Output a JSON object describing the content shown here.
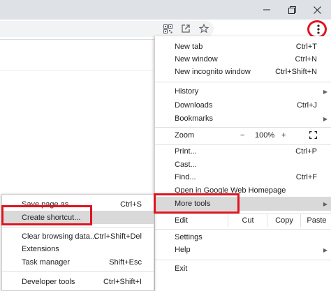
{
  "window": {
    "minimize_icon": "minimize-icon",
    "maximize_icon": "restore-icon",
    "close_icon": "close-icon"
  },
  "toolbar": {
    "icons": [
      "qr-code-icon",
      "open-in-new-icon",
      "star-icon",
      "more-vert-icon"
    ]
  },
  "menu": {
    "new_tab": {
      "label": "New tab",
      "shortcut": "Ctrl+T"
    },
    "new_window": {
      "label": "New window",
      "shortcut": "Ctrl+N"
    },
    "new_incognito": {
      "label": "New incognito window",
      "shortcut": "Ctrl+Shift+N"
    },
    "history": {
      "label": "History"
    },
    "downloads": {
      "label": "Downloads",
      "shortcut": "Ctrl+J"
    },
    "bookmarks": {
      "label": "Bookmarks"
    },
    "zoom": {
      "label": "Zoom",
      "minus": "−",
      "value": "100%",
      "plus": "+"
    },
    "print": {
      "label": "Print...",
      "shortcut": "Ctrl+P"
    },
    "cast": {
      "label": "Cast..."
    },
    "find": {
      "label": "Find...",
      "shortcut": "Ctrl+F"
    },
    "open_in": {
      "label": "Open in Google Web Homepage"
    },
    "more_tools": {
      "label": "More tools"
    },
    "edit": {
      "label": "Edit",
      "cut": "Cut",
      "copy": "Copy",
      "paste": "Paste"
    },
    "settings": {
      "label": "Settings"
    },
    "help": {
      "label": "Help"
    },
    "exit": {
      "label": "Exit"
    }
  },
  "submenu": {
    "save_page": {
      "label": "Save page as...",
      "shortcut": "Ctrl+S"
    },
    "create_shortcut": {
      "label": "Create shortcut..."
    },
    "clear_browsing": {
      "label": "Clear browsing data...",
      "shortcut": "Ctrl+Shift+Del"
    },
    "extensions": {
      "label": "Extensions"
    },
    "task_manager": {
      "label": "Task manager",
      "shortcut": "Shift+Esc"
    },
    "developer_tools": {
      "label": "Developer tools",
      "shortcut": "Ctrl+Shift+I"
    }
  },
  "colors": {
    "highlight_box": "#e0131f",
    "menu_hover": "#d9d9d9",
    "titlebar": "#dee1e6"
  }
}
